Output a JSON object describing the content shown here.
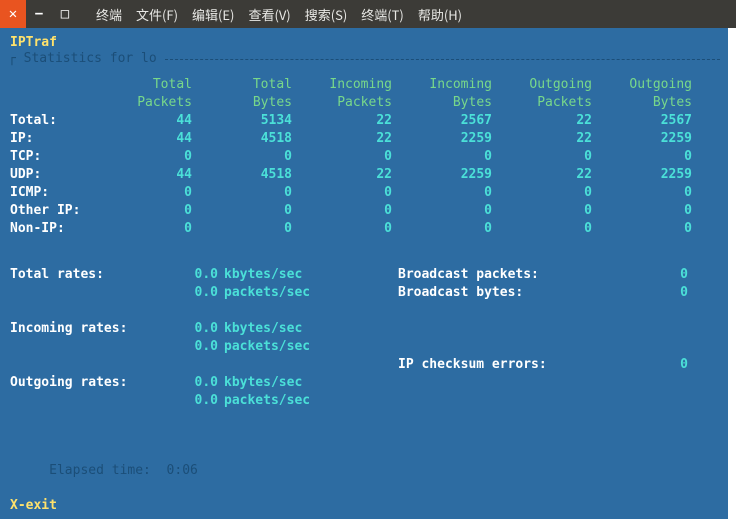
{
  "window": {
    "close_glyph": "✕",
    "min_glyph": "−",
    "max_glyph": "□"
  },
  "menu": {
    "items": [
      "终端",
      "文件(F)",
      "编辑(E)",
      "查看(V)",
      "搜索(S)",
      "终端(T)",
      "帮助(H)"
    ]
  },
  "app": {
    "title": "IPTraf",
    "frame_label": " Statistics for lo ",
    "elapsed_label": " Elapsed time:",
    "elapsed_value": "  0:06",
    "exit": "X-exit"
  },
  "headers": {
    "row1": [
      "Total",
      "Total",
      "Incoming",
      "Incoming",
      "Outgoing",
      "Outgoing"
    ],
    "row2": [
      "Packets",
      "Bytes",
      "Packets",
      "Bytes",
      "Packets",
      "Bytes"
    ]
  },
  "rows": [
    {
      "label": "Total:",
      "v": [
        "44",
        "5134",
        "22",
        "2567",
        "22",
        "2567"
      ]
    },
    {
      "label": "IP:",
      "v": [
        "44",
        "4518",
        "22",
        "2259",
        "22",
        "2259"
      ]
    },
    {
      "label": "TCP:",
      "v": [
        "0",
        "0",
        "0",
        "0",
        "0",
        "0"
      ]
    },
    {
      "label": "UDP:",
      "v": [
        "44",
        "4518",
        "22",
        "2259",
        "22",
        "2259"
      ]
    },
    {
      "label": "ICMP:",
      "v": [
        "0",
        "0",
        "0",
        "0",
        "0",
        "0"
      ]
    },
    {
      "label": "Other IP:",
      "v": [
        "0",
        "0",
        "0",
        "0",
        "0",
        "0"
      ]
    },
    {
      "label": "Non-IP:",
      "v": [
        "0",
        "0",
        "0",
        "0",
        "0",
        "0"
      ]
    }
  ],
  "rates": {
    "total_label": "Total rates:",
    "incoming_label": "Incoming rates:",
    "outgoing_label": "Outgoing rates:",
    "kb": "0.0",
    "pk": "0.0",
    "kb_unit": "kbytes/sec",
    "pk_unit": "packets/sec"
  },
  "right": {
    "bcast_pkts_label": "Broadcast packets:",
    "bcast_pkts_val": "0",
    "bcast_bytes_label": "Broadcast bytes:",
    "bcast_bytes_val": "0",
    "cksum_label": "IP checksum errors:",
    "cksum_val": "0"
  }
}
